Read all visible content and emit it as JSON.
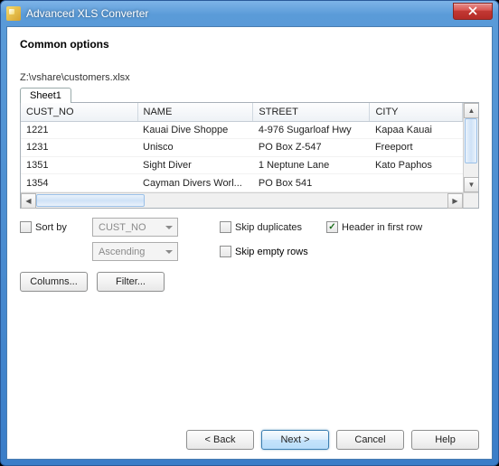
{
  "window": {
    "title": "Advanced XLS Converter"
  },
  "page": {
    "heading": "Common options",
    "filepath": "Z:\\vshare\\customers.xlsx"
  },
  "tabs": {
    "sheet1": "Sheet1"
  },
  "grid": {
    "headers": {
      "cust_no": "CUST_NO",
      "name": "NAME",
      "street": "STREET",
      "city": "CITY"
    },
    "rows": [
      {
        "cust_no": "1221",
        "name": "Kauai Dive Shoppe",
        "street": "4-976 Sugarloaf Hwy",
        "city": "Kapaa Kauai"
      },
      {
        "cust_no": "1231",
        "name": "Unisco",
        "street": "PO Box Z-547",
        "city": "Freeport"
      },
      {
        "cust_no": "1351",
        "name": "Sight Diver",
        "street": "1 Neptune Lane",
        "city": "Kato Paphos"
      },
      {
        "cust_no": "1354",
        "name": "Cayman Divers Worl...",
        "street": "PO Box 541",
        "city": ""
      }
    ]
  },
  "options": {
    "sort_by_label": "Sort by",
    "sort_by_checked": false,
    "sort_field": "CUST_NO",
    "sort_order": "Ascending",
    "skip_duplicates_label": "Skip duplicates",
    "skip_duplicates_checked": false,
    "header_first_row_label": "Header in first row",
    "header_first_row_checked": true,
    "skip_empty_rows_label": "Skip empty rows",
    "skip_empty_rows_checked": false
  },
  "buttons": {
    "columns": "Columns...",
    "filter": "Filter...",
    "back": "< Back",
    "next": "Next >",
    "cancel": "Cancel",
    "help": "Help"
  }
}
